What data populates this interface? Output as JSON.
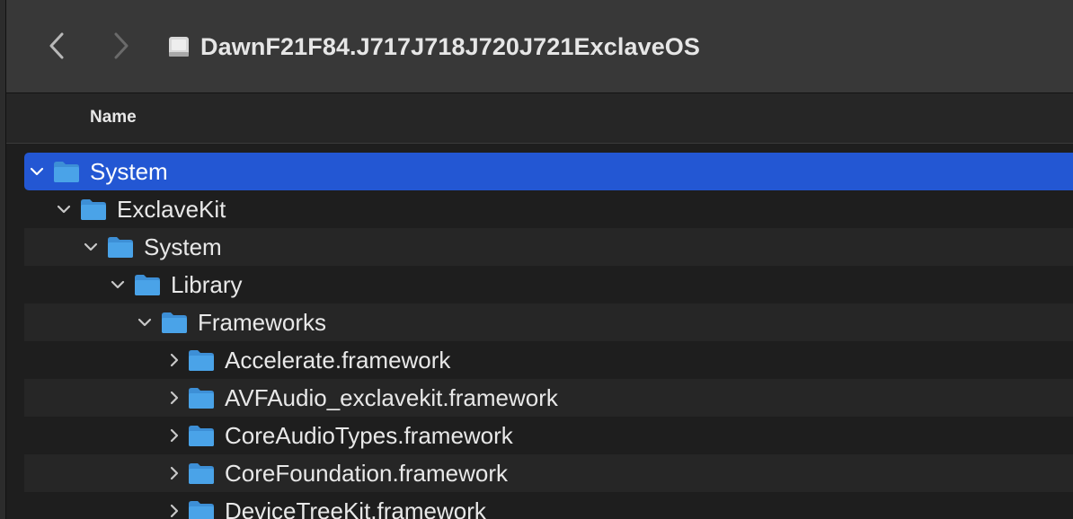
{
  "toolbar": {
    "back_icon": "chevron-left-icon",
    "forward_icon": "chevron-right-icon",
    "drive_icon": "disk-image-icon",
    "title": "DawnF21F84.J717J718J720J721ExclaveOS"
  },
  "columns": {
    "name": "Name"
  },
  "rows": [
    {
      "label": "System",
      "expanded": true,
      "selected": true,
      "level": 0
    },
    {
      "label": "ExclaveKit",
      "expanded": true,
      "selected": false,
      "level": 1
    },
    {
      "label": "System",
      "expanded": true,
      "selected": false,
      "level": 2
    },
    {
      "label": "Library",
      "expanded": true,
      "selected": false,
      "level": 3
    },
    {
      "label": "Frameworks",
      "expanded": true,
      "selected": false,
      "level": 4
    },
    {
      "label": "Accelerate.framework",
      "expanded": false,
      "selected": false,
      "level": 5
    },
    {
      "label": "AVFAudio_exclavekit.framework",
      "expanded": false,
      "selected": false,
      "level": 5
    },
    {
      "label": "CoreAudioTypes.framework",
      "expanded": false,
      "selected": false,
      "level": 5
    },
    {
      "label": "CoreFoundation.framework",
      "expanded": false,
      "selected": false,
      "level": 5
    },
    {
      "label": "DeviceTreeKit.framework",
      "expanded": false,
      "selected": false,
      "level": 5
    }
  ],
  "colors": {
    "selection": "#2357d3",
    "folder": "#4aa3e8"
  }
}
